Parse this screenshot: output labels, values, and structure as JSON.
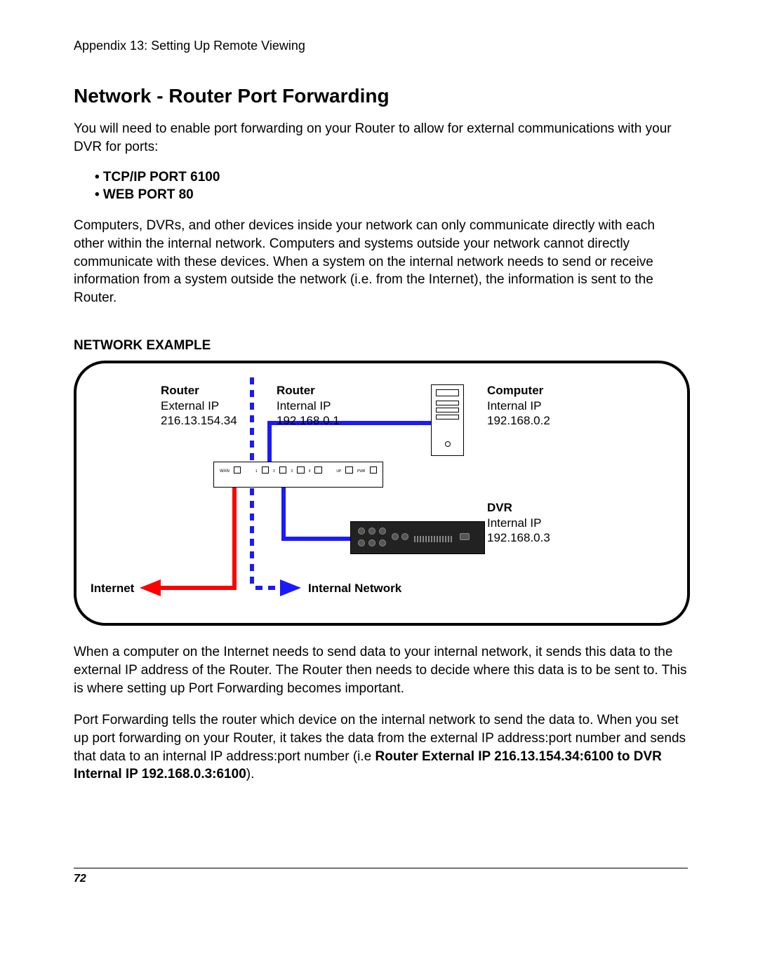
{
  "header": "Appendix 13: Setting Up Remote Viewing",
  "title": "Network - Router Port Forwarding",
  "intro": "You will need to enable port forwarding on your Router to allow for external communications with your DVR for ports:",
  "ports": {
    "tcpip": "• TCP/IP PORT 6100",
    "web": "• WEB PORT 80"
  },
  "para2": "Computers, DVRs, and other devices inside your network can only communicate directly with each other within the internal network. Computers and systems outside your network cannot directly communicate with these devices. When a system on the internal network needs to send or receive information from a system outside the network (i.e. from the Internet), the information is sent to the Router.",
  "section_label": "NETWORK EXAMPLE",
  "diagram": {
    "router_ext": {
      "title": "Router",
      "line1": "External IP",
      "line2": "216.13.154.34"
    },
    "router_int": {
      "title": "Router",
      "line1": "Internal IP",
      "line2": "192.168.0.1"
    },
    "computer": {
      "title": "Computer",
      "line1": "Internal IP",
      "line2": "192.168.0.2"
    },
    "dvr": {
      "title": "DVR",
      "line1": "Internal IP",
      "line2": "192.168.0.3"
    },
    "internet": "Internet",
    "internal": "Internal Network",
    "router_ports": {
      "wan": "WAN",
      "p1": "1",
      "p2": "2",
      "p3": "3",
      "p4": "4",
      "up": "UP",
      "pwr": "PWR"
    }
  },
  "para3": "When a computer on the Internet needs to send data to your internal network, it sends this data to the external IP address of the Router. The Router then needs to decide where this data is to be sent to. This is where setting up Port Forwarding becomes important.",
  "para4a": "Port Forwarding tells the router which device on the internal network to send the data to. When you set up port forwarding on your Router, it takes the data from the external IP address:port number and sends that data to an internal IP address:port number (i.e ",
  "para4b": "Router External IP 216.13.154.34:6100 to DVR Internal IP 192.168.0.3:6100",
  "para4c": ").",
  "page_number": "72"
}
